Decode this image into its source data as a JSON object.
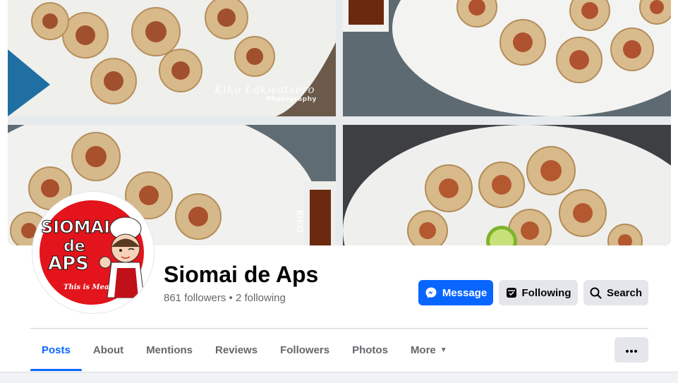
{
  "cover": {
    "watermark_script": "Kiko Lakwatsero",
    "watermark_sub": "Photography",
    "tile_label": "KIKO"
  },
  "avatar": {
    "logo_line1": "SIOMAI",
    "logo_line2": "de",
    "logo_line3": "APS",
    "tagline": "This is Meat!"
  },
  "page": {
    "name": "Siomai de Aps",
    "followers": "861 followers",
    "separator": " • ",
    "following": "2 following"
  },
  "actions": {
    "message": "Message",
    "following": "Following",
    "search": "Search"
  },
  "tabs": [
    {
      "label": "Posts",
      "active": true
    },
    {
      "label": "About"
    },
    {
      "label": "Mentions"
    },
    {
      "label": "Reviews"
    },
    {
      "label": "Followers"
    },
    {
      "label": "Photos"
    },
    {
      "label": "More"
    }
  ],
  "icons": {
    "message": "messenger-icon",
    "following": "following-check-icon",
    "search": "search-icon",
    "more": "caret-down-icon",
    "options": "ellipsis-icon"
  },
  "colors": {
    "accent": "#0866ff",
    "button_gray": "#e4e6eb",
    "text_primary": "#050505",
    "text_secondary": "#65676b",
    "logo_red": "#e3141b"
  }
}
